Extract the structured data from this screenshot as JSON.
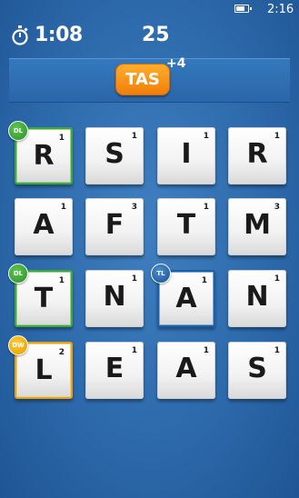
{
  "status_bar": {
    "time": "2:16",
    "battery_icon": "battery-icon"
  },
  "header": {
    "timer_icon": "stopwatch-icon",
    "timer": "1:08",
    "score": "25"
  },
  "current_word": {
    "text": "TAS",
    "bonus": "+4"
  },
  "board": {
    "rows": [
      [
        {
          "letter": "R",
          "points": "1",
          "bonus": "DL"
        },
        {
          "letter": "S",
          "points": "1"
        },
        {
          "letter": "I",
          "points": "1"
        },
        {
          "letter": "R",
          "points": "1"
        }
      ],
      [
        {
          "letter": "A",
          "points": "1"
        },
        {
          "letter": "F",
          "points": "3"
        },
        {
          "letter": "T",
          "points": "1"
        },
        {
          "letter": "M",
          "points": "3"
        }
      ],
      [
        {
          "letter": "T",
          "points": "1",
          "bonus": "DL"
        },
        {
          "letter": "N",
          "points": "1"
        },
        {
          "letter": "A",
          "points": "1",
          "bonus": "TL"
        },
        {
          "letter": "N",
          "points": "1"
        }
      ],
      [
        {
          "letter": "L",
          "points": "2",
          "bonus": "DW"
        },
        {
          "letter": "E",
          "points": "1"
        },
        {
          "letter": "A",
          "points": "1"
        },
        {
          "letter": "S",
          "points": "1"
        }
      ]
    ]
  }
}
